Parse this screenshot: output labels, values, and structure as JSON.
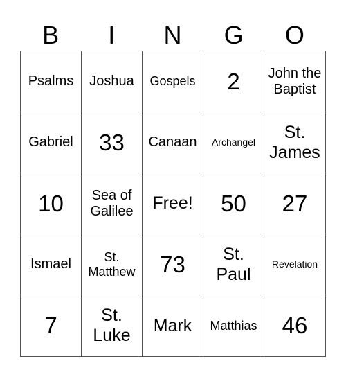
{
  "header": [
    "B",
    "I",
    "N",
    "G",
    "O"
  ],
  "cells": [
    {
      "text": "Psalms",
      "size": "ml"
    },
    {
      "text": "Joshua",
      "size": "ml"
    },
    {
      "text": "Gospels",
      "size": "m"
    },
    {
      "text": "2",
      "size": "xl"
    },
    {
      "text": "John the Baptist",
      "size": "ml"
    },
    {
      "text": "Gabriel",
      "size": "ml"
    },
    {
      "text": "33",
      "size": "xl"
    },
    {
      "text": "Canaan",
      "size": "ml"
    },
    {
      "text": "Archangel",
      "size": "s"
    },
    {
      "text": "St. James",
      "size": "l"
    },
    {
      "text": "10",
      "size": "xl"
    },
    {
      "text": "Sea of Galilee",
      "size": "ml"
    },
    {
      "text": "Free!",
      "size": "l"
    },
    {
      "text": "50",
      "size": "xl"
    },
    {
      "text": "27",
      "size": "xl"
    },
    {
      "text": "Ismael",
      "size": "ml"
    },
    {
      "text": "St. Matthew",
      "size": "m"
    },
    {
      "text": "73",
      "size": "xl"
    },
    {
      "text": "St. Paul",
      "size": "l"
    },
    {
      "text": "Revelation",
      "size": "s"
    },
    {
      "text": "7",
      "size": "xl"
    },
    {
      "text": "St. Luke",
      "size": "l"
    },
    {
      "text": "Mark",
      "size": "l"
    },
    {
      "text": "Matthias",
      "size": "m"
    },
    {
      "text": "46",
      "size": "xl"
    }
  ]
}
